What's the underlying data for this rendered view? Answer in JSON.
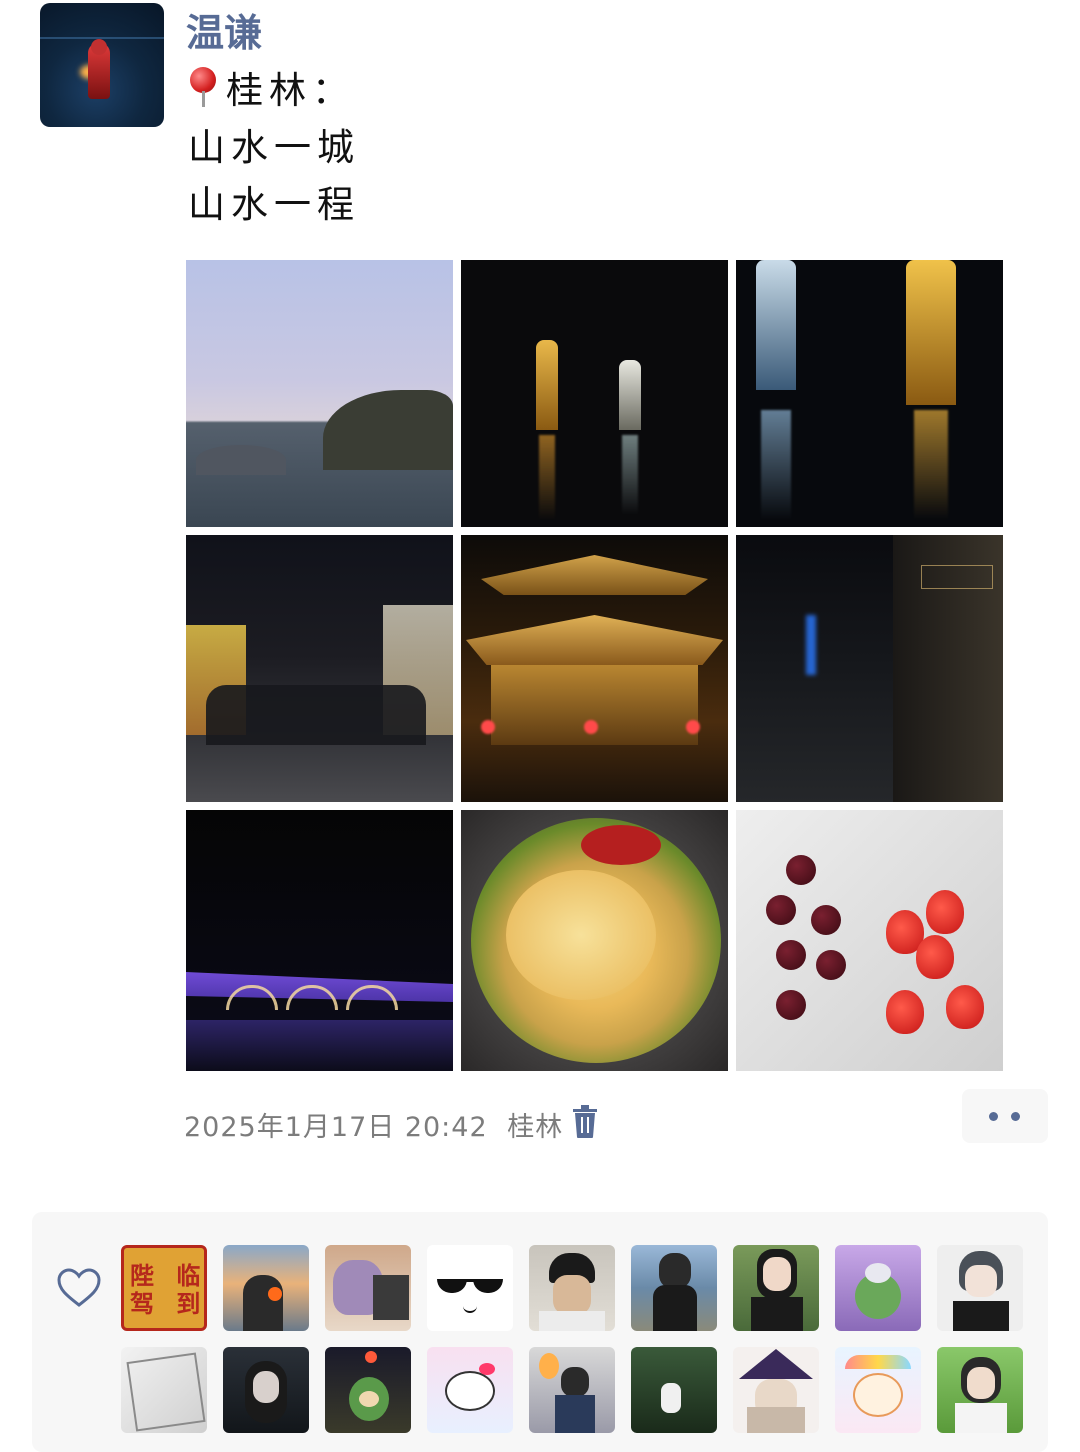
{
  "post": {
    "username": "温谦",
    "location_line": "桂林：",
    "lines": [
      "山水一城",
      "山水一程"
    ],
    "photo_count": 9
  },
  "meta": {
    "datetime": "2025年1月17日 20:42",
    "location": "桂林"
  },
  "icons": {
    "location": "pushpin-icon",
    "delete": "trash-icon",
    "more": "more-dots-icon",
    "like": "heart-outline-icon"
  },
  "colors": {
    "username": "#576b95",
    "meta": "#7c7c7c",
    "panel": "#f7f7f7"
  },
  "likes": {
    "visible_avatar_count": 18,
    "avatar_badge_text": [
      "陛",
      "临",
      "驾",
      "到"
    ]
  }
}
